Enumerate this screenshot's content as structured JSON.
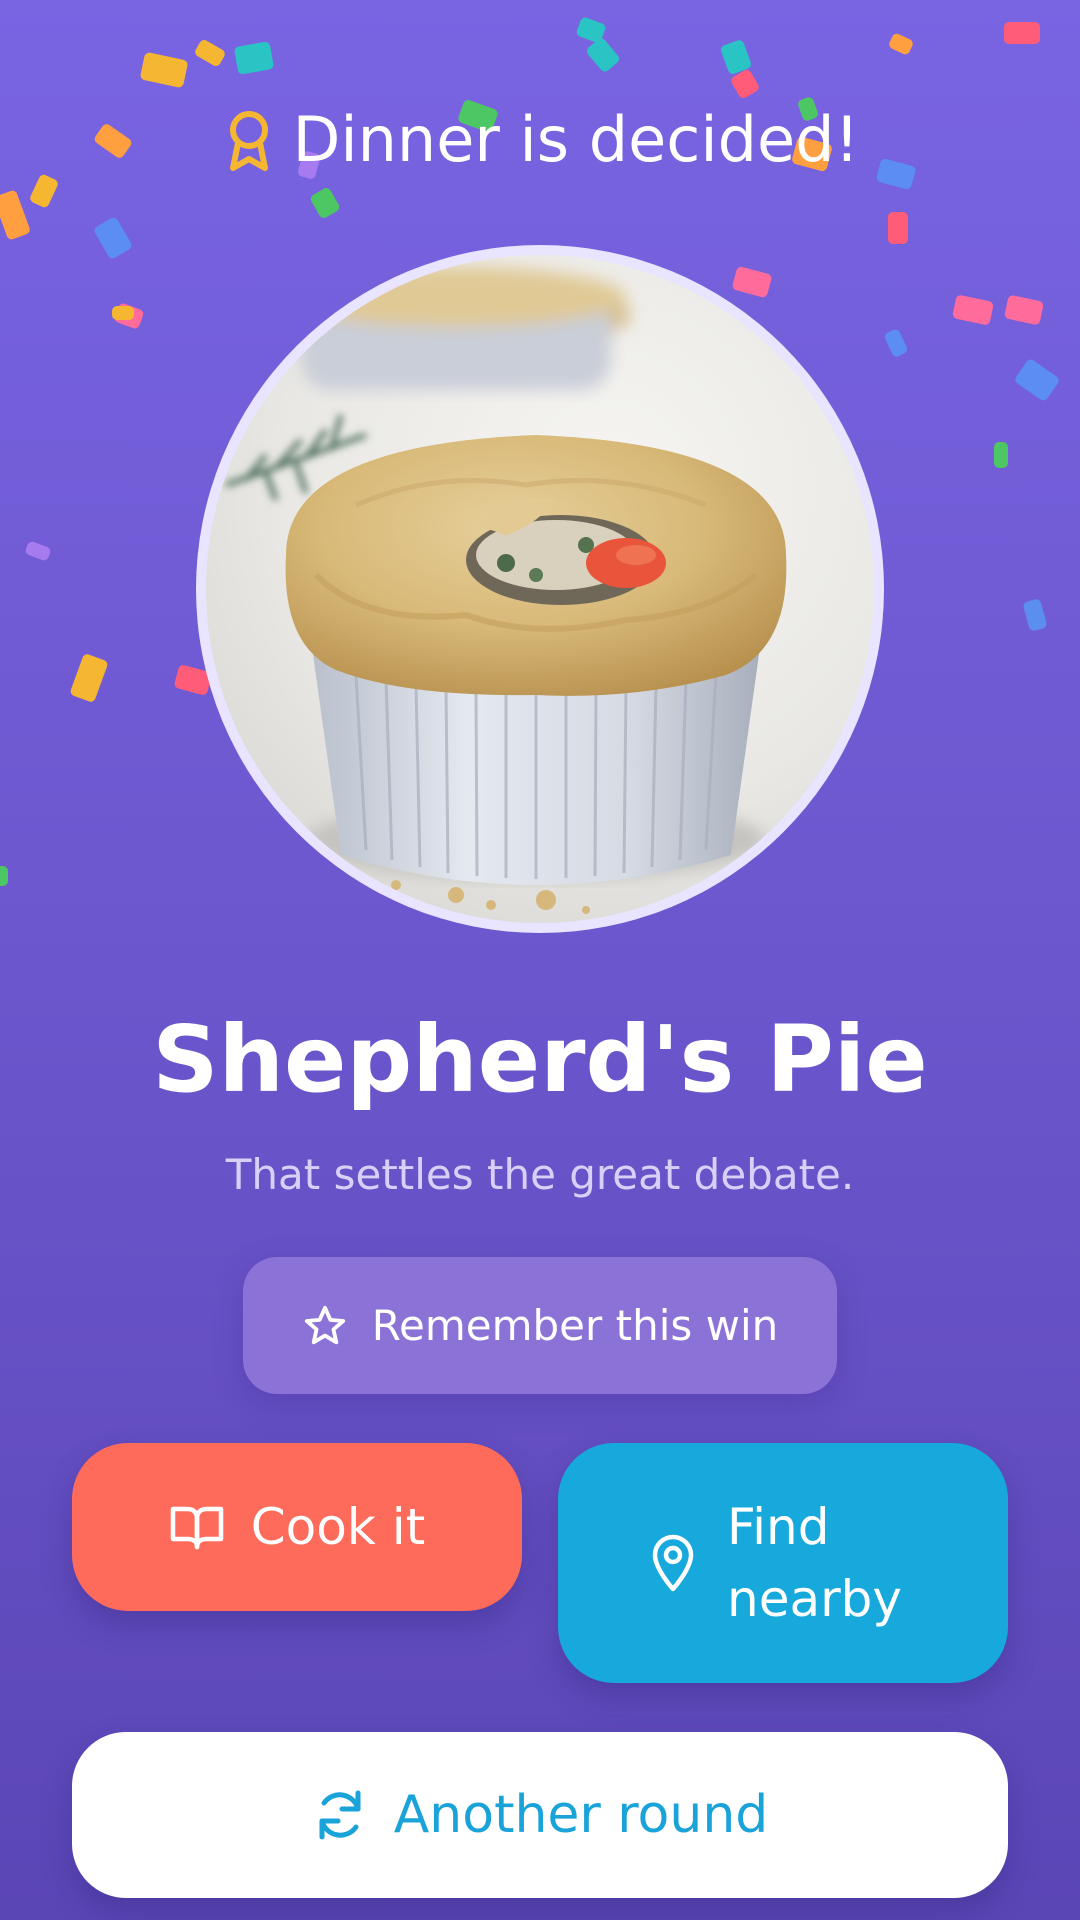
{
  "header": {
    "title": "Dinner is decided!",
    "icon": "award-icon",
    "icon_color": "#f5b731"
  },
  "dish": {
    "name": "Shepherd's Pie",
    "tagline": "That settles the great debate.",
    "photo": "pot-pie-photo"
  },
  "actions": {
    "remember": {
      "label": "Remember this win",
      "icon": "star-icon"
    },
    "cook": {
      "label": "Cook it",
      "icon": "book-open-icon",
      "color": "#ff6b5b"
    },
    "nearby": {
      "label": "Find nearby",
      "icon": "map-pin-icon",
      "color": "#17a8dc"
    },
    "another_round": {
      "label": "Another round",
      "icon": "refresh-icon",
      "color": "#1aa3d8"
    }
  },
  "theme": {
    "background_top": "#7964e2",
    "background_bottom": "#5b46b6",
    "confetti_colors": [
      "#f5b731",
      "#ff9f40",
      "#2bc4c4",
      "#5b8ef0",
      "#ff6b9a",
      "#4cc764",
      "#ff5c7a",
      "#a77bf0"
    ]
  }
}
